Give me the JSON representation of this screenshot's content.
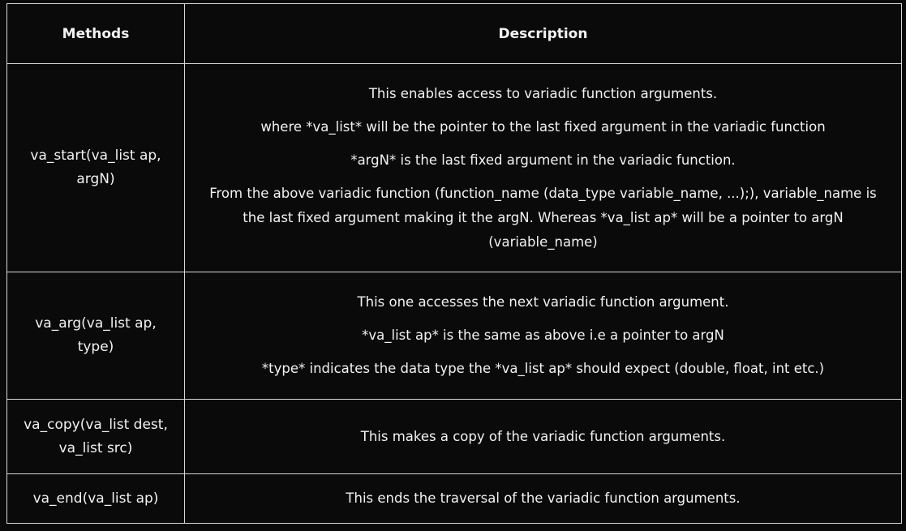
{
  "headers": {
    "methods": "Methods",
    "description": "Description"
  },
  "rows": [
    {
      "method": "va_start(va_list ap, argN)",
      "description": [
        "This enables access to variadic function arguments.",
        "where *va_list* will be the pointer to the last fixed argument in the variadic function",
        "*argN* is the last fixed argument in the variadic function.",
        "From the above variadic function (function_name (data_type variable_name, ...);), variable_name is the last fixed argument making it the argN. Whereas *va_list ap* will be a pointer to argN (variable_name)"
      ]
    },
    {
      "method": "va_arg(va_list ap, type)",
      "description": [
        "This one accesses the next variadic function argument.",
        "*va_list ap* is the same as above i.e a pointer to argN",
        "*type* indicates the data type  the *va_list ap* should expect (double, float, int etc.)"
      ]
    },
    {
      "method": "va_copy(va_list dest, va_list src)",
      "description": [
        "This makes a copy of the variadic function arguments."
      ]
    },
    {
      "method": "va_end(va_list ap)",
      "description": [
        "This ends the traversal of the variadic function arguments."
      ]
    }
  ]
}
